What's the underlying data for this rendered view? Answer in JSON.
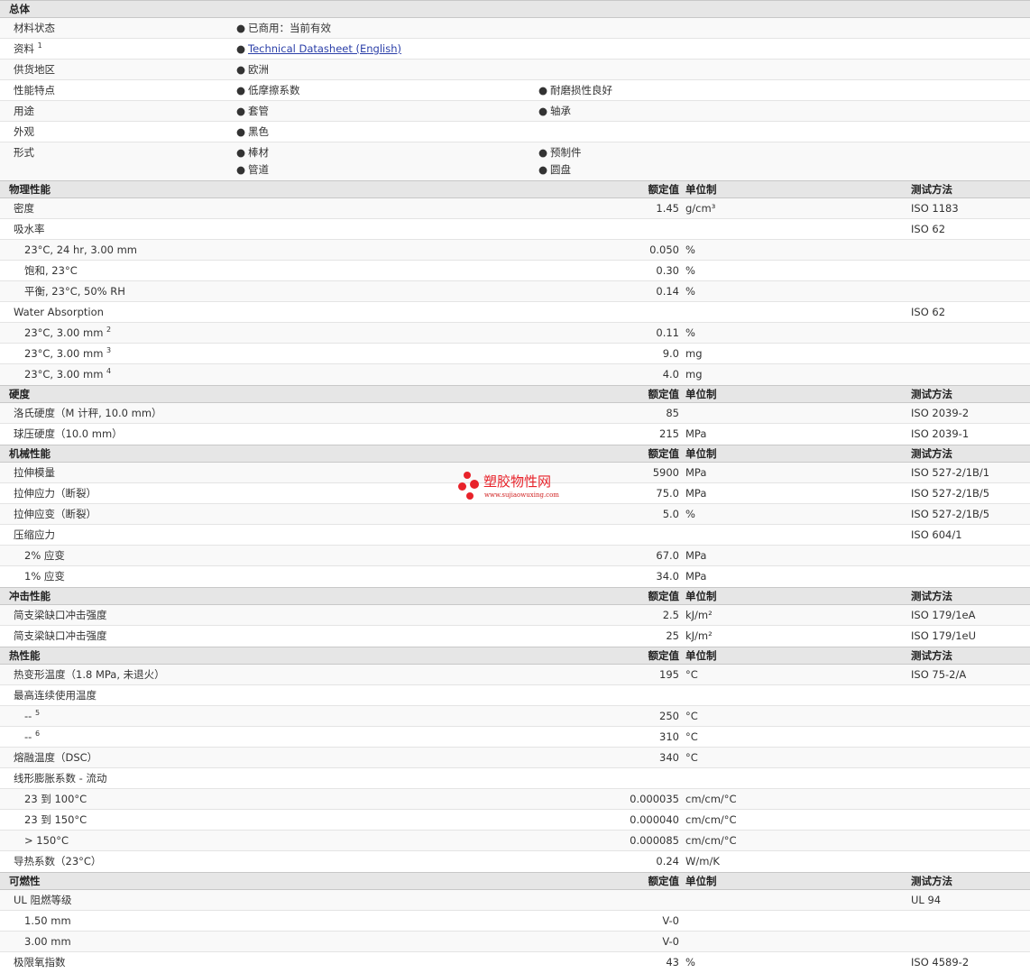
{
  "general": {
    "title": "总体",
    "status_label": "材料状态",
    "status_value": "已商用：当前有效",
    "resource_label": "资料",
    "resource_sup": "1",
    "resource_link": "Technical Datasheet (English)",
    "region_label": "供货地区",
    "region_value": "欧洲",
    "features_label": "性能特点",
    "features": [
      "低摩擦系数",
      "耐磨损性良好"
    ],
    "uses_label": "用途",
    "uses": [
      "套管",
      "轴承"
    ],
    "appearance_label": "外观",
    "appearance_value": "黑色",
    "forms_label": "形式",
    "forms": [
      "棒材",
      "预制件",
      "管道",
      "圆盘"
    ]
  },
  "headers": {
    "nominal": "额定值",
    "unit": "单位制",
    "method": "测试方法"
  },
  "physical": {
    "title": "物理性能",
    "density": {
      "name": "密度",
      "value": "1.45",
      "unit": "g/cm³",
      "method": "ISO 1183"
    },
    "absorption": {
      "name": "吸水率",
      "method": "ISO 62"
    },
    "abs1": {
      "name": "23°C, 24 hr, 3.00 mm",
      "value": "0.050",
      "unit": "%"
    },
    "abs2": {
      "name": "饱和, 23°C",
      "value": "0.30",
      "unit": "%"
    },
    "abs3": {
      "name": "平衡, 23°C, 50% RH",
      "value": "0.14",
      "unit": "%"
    },
    "water": {
      "name": "Water Absorption",
      "method": "ISO 62"
    },
    "wa1": {
      "name": "23°C, 3.00 mm",
      "sup": "2",
      "value": "0.11",
      "unit": "%"
    },
    "wa2": {
      "name": "23°C, 3.00 mm",
      "sup": "3",
      "value": "9.0",
      "unit": "mg"
    },
    "wa3": {
      "name": "23°C, 3.00 mm",
      "sup": "4",
      "value": "4.0",
      "unit": "mg"
    }
  },
  "hardness": {
    "title": "硬度",
    "rockwell": {
      "name": "洛氏硬度（M 计秤, 10.0 mm）",
      "value": "85",
      "method": "ISO 2039-2"
    },
    "ball": {
      "name": "球压硬度（10.0 mm）",
      "value": "215",
      "unit": "MPa",
      "method": "ISO 2039-1"
    }
  },
  "mechanical": {
    "title": "机械性能",
    "modulus": {
      "name": "拉伸模量",
      "value": "5900",
      "unit": "MPa",
      "method": "ISO 527-2/1B/1"
    },
    "stress": {
      "name": "拉伸应力（断裂）",
      "value": "75.0",
      "unit": "MPa",
      "method": "ISO 527-2/1B/5"
    },
    "strain": {
      "name": "拉伸应变（断裂）",
      "value": "5.0",
      "unit": "%",
      "method": "ISO 527-2/1B/5"
    },
    "compress": {
      "name": "压缩应力",
      "method": "ISO 604/1"
    },
    "c2": {
      "name": "2% 应变",
      "value": "67.0",
      "unit": "MPa"
    },
    "c1": {
      "name": "1% 应变",
      "value": "34.0",
      "unit": "MPa"
    }
  },
  "impact": {
    "title": "冲击性能",
    "notched": {
      "name": "简支梁缺口冲击强度",
      "value": "2.5",
      "unit": "kJ/m²",
      "method": "ISO 179/1eA"
    },
    "unnotched": {
      "name": "简支梁缺口冲击强度",
      "value": "25",
      "unit": "kJ/m²",
      "method": "ISO 179/1eU"
    }
  },
  "thermal": {
    "title": "热性能",
    "hdt": {
      "name": "热变形温度（1.8 MPa, 未退火）",
      "value": "195",
      "unit": "°C",
      "method": "ISO 75-2/A"
    },
    "maxuse": {
      "name": "最高连续使用温度"
    },
    "mu1": {
      "name": "--",
      "sup": "5",
      "value": "250",
      "unit": "°C"
    },
    "mu2": {
      "name": "--",
      "sup": "6",
      "value": "310",
      "unit": "°C"
    },
    "melt": {
      "name": "熔融温度（DSC）",
      "value": "340",
      "unit": "°C"
    },
    "clte": {
      "name": "线形膨胀系数 - 流动"
    },
    "cl1": {
      "name": "23 到 100°C",
      "value": "0.000035",
      "unit": "cm/cm/°C"
    },
    "cl2": {
      "name": "23 到 150°C",
      "value": "0.000040",
      "unit": "cm/cm/°C"
    },
    "cl3": {
      "name": "> 150°C",
      "value": "0.000085",
      "unit": "cm/cm/°C"
    },
    "conduct": {
      "name": "导热系数（23°C）",
      "value": "0.24",
      "unit": "W/m/K"
    }
  },
  "flammability": {
    "title": "可燃性",
    "ul": {
      "name": "UL 阻燃等级",
      "method": "UL 94"
    },
    "ul1": {
      "name": "1.50 mm",
      "value": "V-0"
    },
    "ul2": {
      "name": "3.00 mm",
      "value": "V-0"
    },
    "loi": {
      "name": "极限氧指数",
      "value": "43",
      "unit": "%",
      "method": "ISO 4589-2"
    }
  },
  "watermark": {
    "title": "塑胶物性网",
    "url": "www.sujiaowuxing.com",
    "color": "#e8222a"
  }
}
